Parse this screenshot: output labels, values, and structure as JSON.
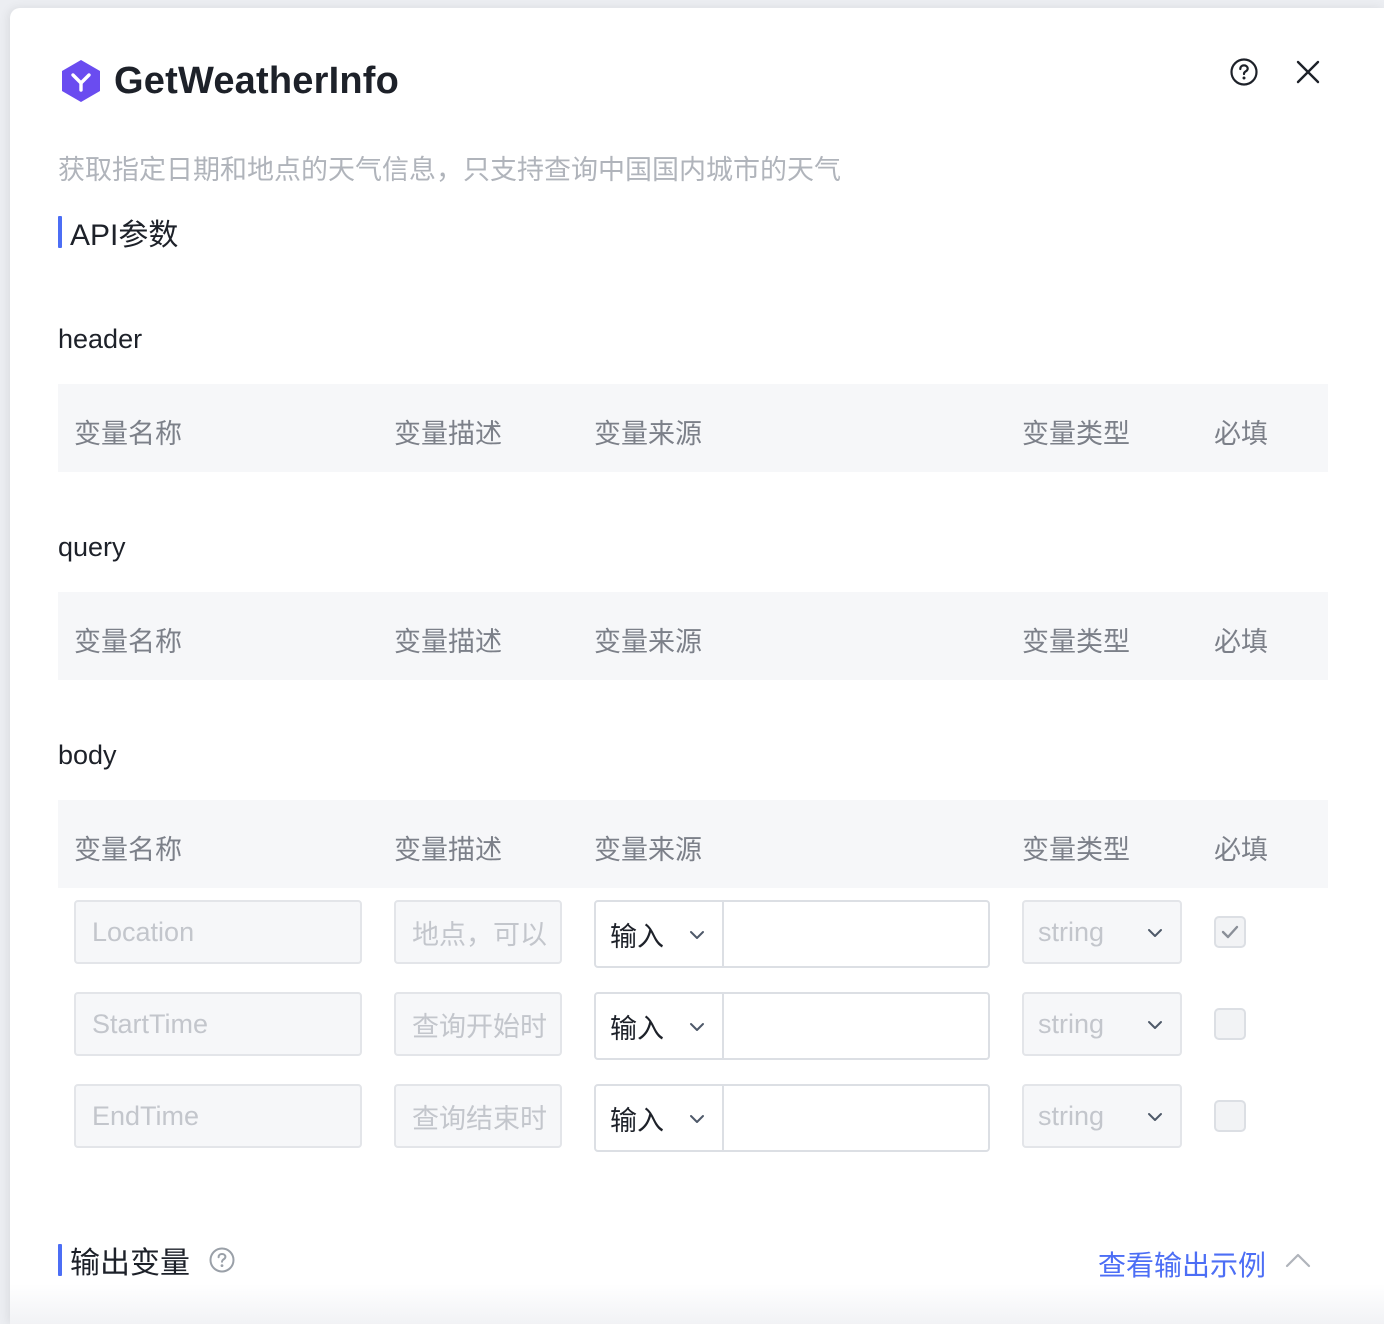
{
  "tool": {
    "title": "GetWeatherInfo",
    "description": "获取指定日期和地点的天气信息，只支持查询中国国内城市的天气"
  },
  "sections": {
    "api_params": "API参数",
    "output_vars": "输出变量",
    "view_output_example": "查看输出示例"
  },
  "groups": {
    "header": "header",
    "query": "query",
    "body": "body"
  },
  "columns": {
    "name": "变量名称",
    "desc": "变量描述",
    "source": "变量来源",
    "type": "变量类型",
    "required": "必填"
  },
  "body_rows": [
    {
      "name": "Location",
      "desc": "地点，可以",
      "source": "输入",
      "value": "",
      "type": "string",
      "required": true
    },
    {
      "name": "StartTime",
      "desc": "查询开始时",
      "source": "输入",
      "value": "",
      "type": "string",
      "required": false
    },
    {
      "name": "EndTime",
      "desc": "查询结束时",
      "source": "输入",
      "value": "",
      "type": "string",
      "required": false
    }
  ],
  "colors": {
    "accent": "#4c6ef5",
    "logo": "#6a4cf0"
  }
}
